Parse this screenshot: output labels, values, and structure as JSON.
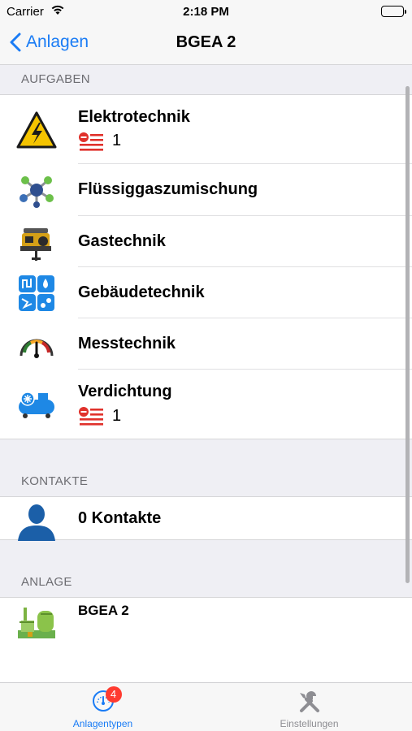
{
  "status_bar": {
    "carrier": "Carrier",
    "time": "2:18 PM"
  },
  "nav": {
    "back_label": "Anlagen",
    "title": "BGEA 2"
  },
  "sections": {
    "aufgaben": {
      "header": "AUFGABEN",
      "items": [
        {
          "label": "Elektrotechnik",
          "icon": "high-voltage-icon",
          "count": "1"
        },
        {
          "label": "Flüssiggaszumischung",
          "icon": "molecule-icon"
        },
        {
          "label": "Gastechnik",
          "icon": "gas-engine-icon"
        },
        {
          "label": "Gebäudetechnik",
          "icon": "building-services-icon"
        },
        {
          "label": "Messtechnik",
          "icon": "gauge-icon"
        },
        {
          "label": "Verdichtung",
          "icon": "compressor-icon",
          "count": "1"
        }
      ]
    },
    "kontakte": {
      "header": "KONTAKTE",
      "label": "0 Kontakte",
      "icon": "person-icon"
    },
    "anlage": {
      "header": "ANLAGE",
      "label": "BGEA 2",
      "icon": "biogas-plant-icon"
    }
  },
  "tab_bar": {
    "tabs": [
      {
        "label": "Anlagentypen",
        "badge": "4",
        "icon": "gauge-tab-icon",
        "active": true
      },
      {
        "label": "Einstellungen",
        "icon": "tools-icon",
        "active": false
      }
    ]
  },
  "colors": {
    "accent": "#1a7cf5",
    "badge": "#ff3b30",
    "task_red": "#e0312b",
    "group_bg": "#efeff4"
  }
}
